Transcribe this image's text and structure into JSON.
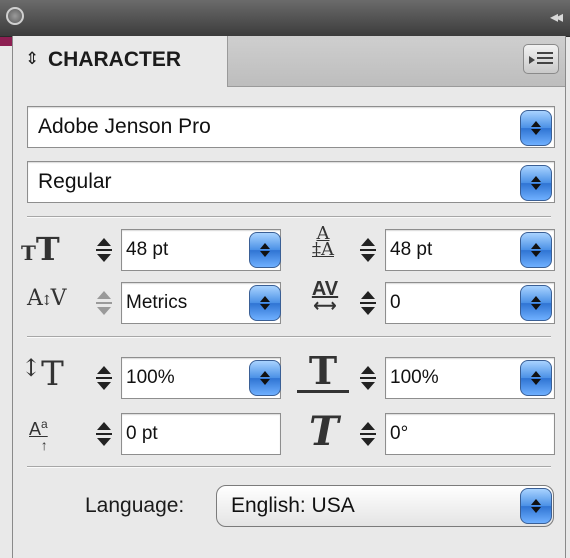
{
  "panel": {
    "tab_label": "CHARACTER",
    "tab_arrow": "⇕",
    "collapse_glyph": "◂◂"
  },
  "font": {
    "family": "Adobe Jenson Pro",
    "style": "Regular"
  },
  "rows": {
    "font_size": {
      "value": "48 pt",
      "icon": "font-size-icon"
    },
    "leading": {
      "value": "48 pt",
      "icon": "leading-icon"
    },
    "kerning": {
      "value": "Metrics",
      "icon": "kerning-icon"
    },
    "tracking": {
      "value": "0",
      "icon": "tracking-icon"
    },
    "vertical_scale": {
      "value": "100%",
      "icon": "vertical-scale-icon"
    },
    "horizontal_scale": {
      "value": "100%",
      "icon": "horizontal-scale-icon"
    },
    "baseline_shift": {
      "value": "0 pt",
      "icon": "baseline-shift-icon"
    },
    "skew": {
      "value": "0°",
      "icon": "skew-icon"
    }
  },
  "language": {
    "label": "Language:",
    "value": "English: USA"
  },
  "colors": {
    "accent": "#8d1f52",
    "aqua_button": "#4a90e6"
  }
}
